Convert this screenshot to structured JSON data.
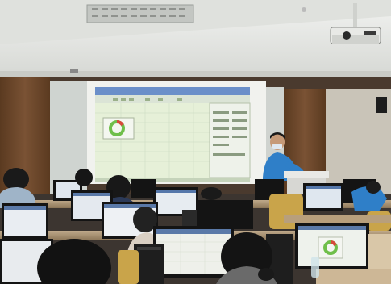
{
  "scene": {
    "kind": "photo",
    "subject": "computer-lab-training-session"
  },
  "colors": {
    "ceiling": "#e9ebe8",
    "wall_wood": "#6e4a2c",
    "projected_sheet": "#e6f0d8",
    "donut_green": "#6fbf4a",
    "donut_red": "#d84a3a",
    "shirt_blue": "#2f7fc8",
    "monitor_bezel": "#141414"
  }
}
